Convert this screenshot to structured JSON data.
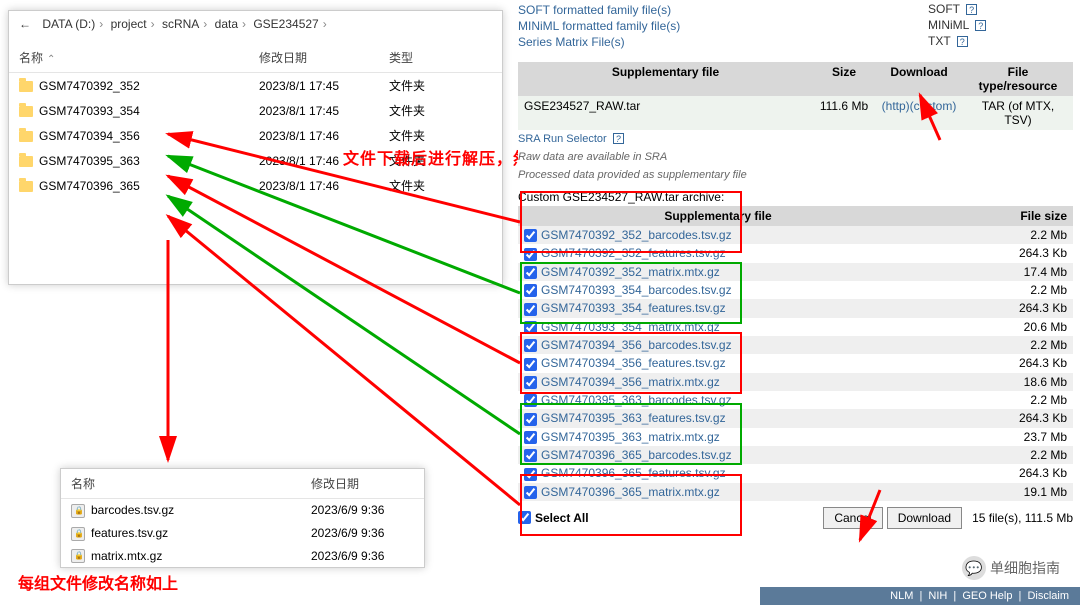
{
  "explorer1": {
    "breadcrumb": [
      "DATA (D:)",
      "project",
      "scRNA",
      "data",
      "GSE234527"
    ],
    "headers": {
      "name": "名称",
      "date": "修改日期",
      "type": "类型"
    },
    "rows": [
      {
        "name": "GSM7470392_352",
        "date": "2023/8/1 17:45",
        "type": "文件夹"
      },
      {
        "name": "GSM7470393_354",
        "date": "2023/8/1 17:45",
        "type": "文件夹"
      },
      {
        "name": "GSM7470394_356",
        "date": "2023/8/1 17:46",
        "type": "文件夹"
      },
      {
        "name": "GSM7470395_363",
        "date": "2023/8/1 17:46",
        "type": "文件夹"
      },
      {
        "name": "GSM7470396_365",
        "date": "2023/8/1 17:46",
        "type": "文件夹"
      }
    ]
  },
  "explorer2": {
    "headers": {
      "name": "名称",
      "date": "修改日期"
    },
    "rows": [
      {
        "name": "barcodes.tsv.gz",
        "date": "2023/6/9 9:36"
      },
      {
        "name": "features.tsv.gz",
        "date": "2023/6/9 9:36"
      },
      {
        "name": "matrix.mtx.gz",
        "date": "2023/6/9 9:36"
      }
    ]
  },
  "annotations": {
    "a1": "文件下载后进行解压，然后将每组文件分别放到一个单独的文件夹下",
    "a2": "每组文件修改名称如上"
  },
  "toplinks": {
    "l1": "SOFT formatted family file(s)",
    "l2": "MINiML formatted family file(s)",
    "l3": "Series Matrix File(s)",
    "v1": "SOFT",
    "v2": "MINiML",
    "v3": "TXT"
  },
  "supp": {
    "h1": "Supplementary file",
    "h2": "Size",
    "h3": "Download",
    "h4": "File type/resource",
    "file": "GSE234527_RAW.tar",
    "size": "111.6 Mb",
    "d1": "(http)",
    "d2": "(custom)",
    "ft": "TAR (of MTX, TSV)",
    "sra": "SRA Run Selector",
    "note1": "Raw data are available in SRA",
    "note2": "Processed data provided as supplementary file"
  },
  "archive": {
    "label": "Custom GSE234527_RAW.tar archive:",
    "h1": "Supplementary file",
    "h2": "File size",
    "rows": [
      {
        "name": "GSM7470392_352_barcodes.tsv.gz",
        "size": "2.2 Mb"
      },
      {
        "name": "GSM7470392_352_features.tsv.gz",
        "size": "264.3 Kb"
      },
      {
        "name": "GSM7470392_352_matrix.mtx.gz",
        "size": "17.4 Mb"
      },
      {
        "name": "GSM7470393_354_barcodes.tsv.gz",
        "size": "2.2 Mb"
      },
      {
        "name": "GSM7470393_354_features.tsv.gz",
        "size": "264.3 Kb"
      },
      {
        "name": "GSM7470393_354_matrix.mtx.gz",
        "size": "20.6 Mb"
      },
      {
        "name": "GSM7470394_356_barcodes.tsv.gz",
        "size": "2.2 Mb"
      },
      {
        "name": "GSM7470394_356_features.tsv.gz",
        "size": "264.3 Kb"
      },
      {
        "name": "GSM7470394_356_matrix.mtx.gz",
        "size": "18.6 Mb"
      },
      {
        "name": "GSM7470395_363_barcodes.tsv.gz",
        "size": "2.2 Mb"
      },
      {
        "name": "GSM7470395_363_features.tsv.gz",
        "size": "264.3 Kb"
      },
      {
        "name": "GSM7470395_363_matrix.mtx.gz",
        "size": "23.7 Mb"
      },
      {
        "name": "GSM7470396_365_barcodes.tsv.gz",
        "size": "2.2 Mb"
      },
      {
        "name": "GSM7470396_365_features.tsv.gz",
        "size": "264.3 Kb"
      },
      {
        "name": "GSM7470396_365_matrix.mtx.gz",
        "size": "19.1 Mb"
      }
    ],
    "selectall": "Select All",
    "cancel": "Cancel",
    "download": "Download",
    "summary": "15 file(s), 111.5 Mb"
  },
  "footer": {
    "nlm": "NLM",
    "nih": "NIH",
    "geo": "GEO Help",
    "dis": "Disclaim"
  },
  "watermark": "单细胞指南"
}
